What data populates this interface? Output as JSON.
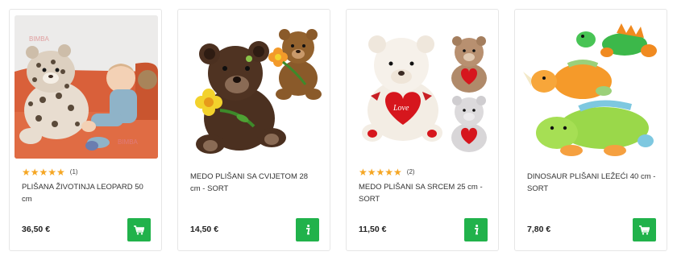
{
  "products": [
    {
      "title": "PLIŠANA ŽIVOTINJA LEOPARD 50 cm",
      "rating_stars": "★★★★★",
      "rating_count": "(1)",
      "price": "36,50 €",
      "action_icon": "cart-icon",
      "watermark": "BIMBA"
    },
    {
      "title": "MEDO PLIŠANI SA CVIJETOM 28 cm - SORT",
      "price": "14,50 €",
      "action_icon": "info-icon"
    },
    {
      "title": "MEDO PLIŠANI SA SRCEM 25 cm - SORT",
      "rating_stars": "★★★★★",
      "rating_count": "(2)",
      "price": "11,50 €",
      "action_icon": "info-icon",
      "heart_text": "Love"
    },
    {
      "title": "DINOSAUR PLIŠANI LEŽEĆI 40 cm - SORT",
      "price": "7,80 €",
      "action_icon": "cart-icon"
    }
  ],
  "colors": {
    "accent_green": "#21b24b",
    "star": "#f5a623"
  }
}
